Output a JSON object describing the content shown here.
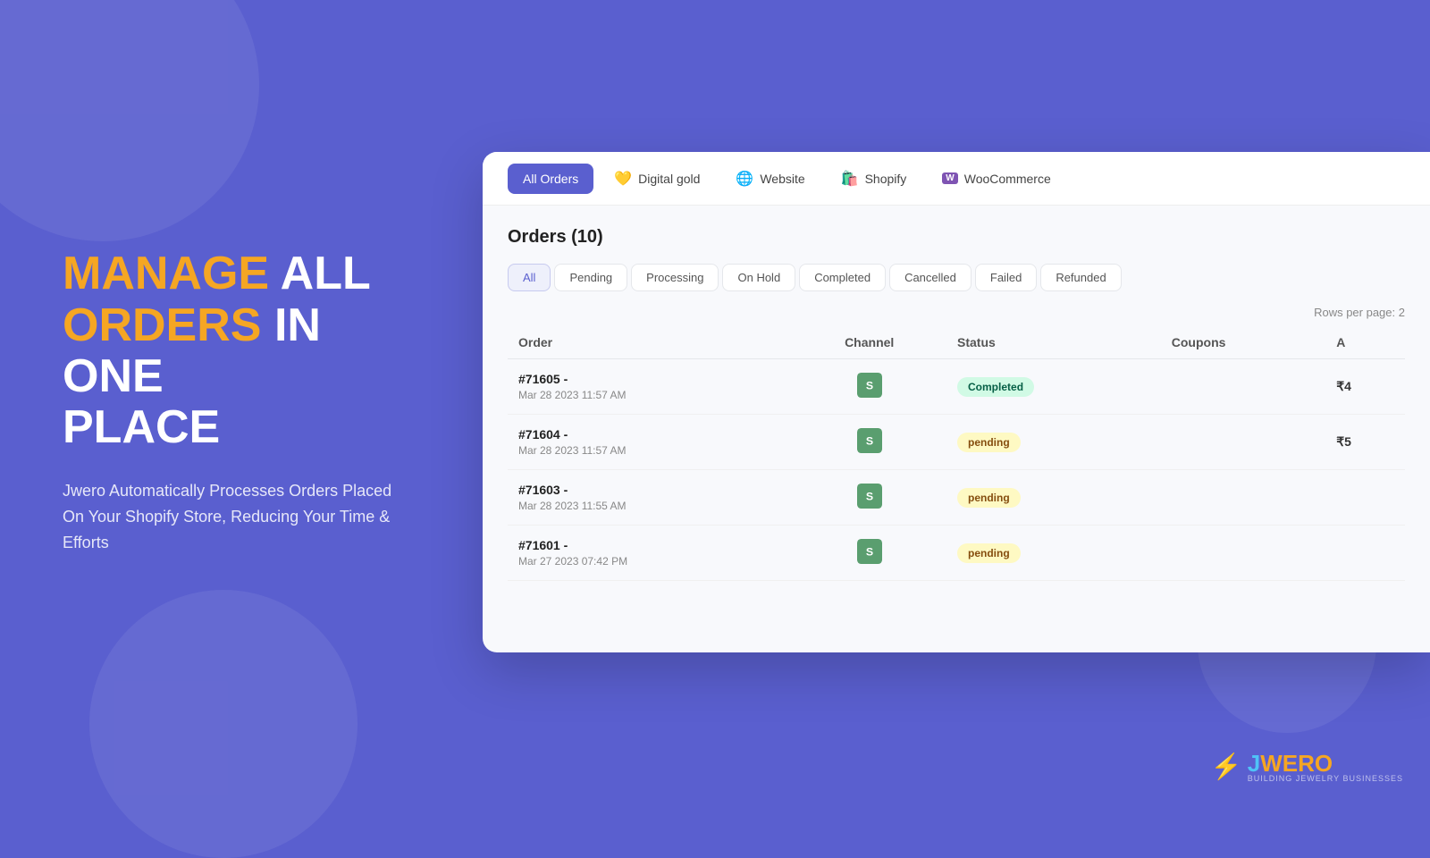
{
  "background": {
    "color": "#5a5fcf"
  },
  "left": {
    "headline_orange1": "MANAGE",
    "headline_white1": "ALL",
    "headline_orange2": "ORDERS",
    "headline_white2": "IN ONE",
    "headline_white3": "PLACE",
    "subtext": "Jwero Automatically Processes Orders Placed On Your Shopify Store, Reducing Your Time & Efforts"
  },
  "card": {
    "tabs": [
      {
        "id": "all-orders",
        "label": "All Orders",
        "active": true,
        "icon": ""
      },
      {
        "id": "digital-gold",
        "label": "Digital gold",
        "active": false,
        "icon": "💛"
      },
      {
        "id": "website",
        "label": "Website",
        "active": false,
        "icon": "🌐"
      },
      {
        "id": "shopify",
        "label": "Shopify",
        "active": false,
        "icon": "🛍️"
      },
      {
        "id": "woocommerce",
        "label": "WooCommerce",
        "active": false,
        "icon": "woo"
      }
    ],
    "orders_title": "Orders (10)",
    "filter_tabs": [
      {
        "id": "all",
        "label": "All",
        "active": true
      },
      {
        "id": "pending",
        "label": "Pending",
        "active": false
      },
      {
        "id": "processing",
        "label": "Processing",
        "active": false
      },
      {
        "id": "on-hold",
        "label": "On Hold",
        "active": false
      },
      {
        "id": "completed",
        "label": "Completed",
        "active": false
      },
      {
        "id": "cancelled",
        "label": "Cancelled",
        "active": false
      },
      {
        "id": "failed",
        "label": "Failed",
        "active": false
      },
      {
        "id": "refunded",
        "label": "Refunded",
        "active": false
      }
    ],
    "rows_per_page_label": "Rows per page:",
    "rows_per_page_value": "2",
    "table": {
      "columns": [
        "Order",
        "Channel",
        "Status",
        "Coupons",
        "A"
      ],
      "rows": [
        {
          "order_number": "#71605 -",
          "order_date": "Mar 28 2023 11:57 AM",
          "channel": "shopify",
          "status": "Completed",
          "status_type": "completed",
          "coupons": "",
          "amount": "₹4"
        },
        {
          "order_number": "#71604 -",
          "order_date": "Mar 28 2023 11:57 AM",
          "channel": "shopify",
          "status": "pending",
          "status_type": "pending",
          "coupons": "",
          "amount": "₹5"
        },
        {
          "order_number": "#71603 -",
          "order_date": "Mar 28 2023 11:55 AM",
          "channel": "shopify",
          "status": "pending",
          "status_type": "pending",
          "coupons": "",
          "amount": ""
        },
        {
          "order_number": "#71601 -",
          "order_date": "Mar 27 2023 07:42 PM",
          "channel": "shopify",
          "status": "pending",
          "status_type": "pending",
          "coupons": "",
          "amount": ""
        }
      ]
    }
  },
  "logo": {
    "j": "J",
    "wero": "WERO",
    "sub": "BUILDING JEWELRY BUSINESSES"
  }
}
